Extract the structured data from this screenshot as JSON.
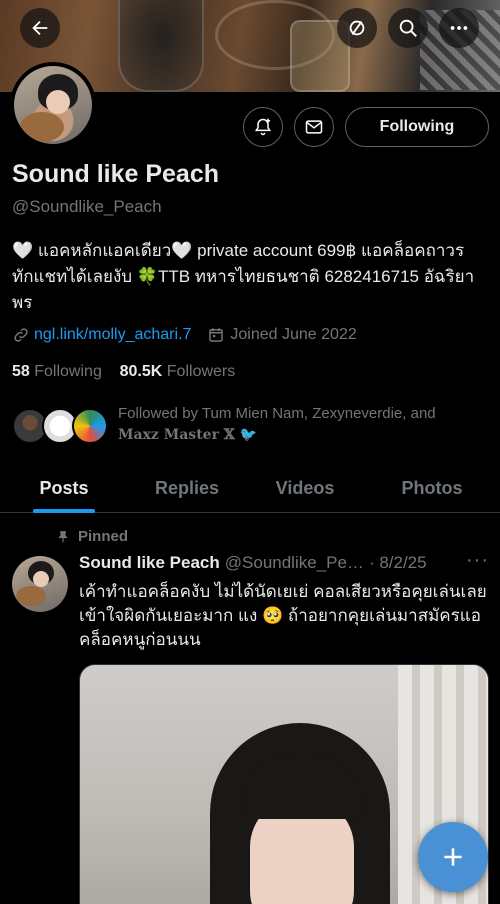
{
  "header": {
    "back_icon": "arrow-left-icon",
    "hide_icon": "circle-slash-icon",
    "search_icon": "search-icon",
    "more_icon": "more-horizontal-icon"
  },
  "profile": {
    "name": "Sound like Peach",
    "handle": "@Soundlike_Peach",
    "bio": "🤍 แอคหลักแอคเดียว🤍 private account 699฿ แอคล็อคถาวร ทักแชทได้เลยงับ 🍀TTB ทหารไทยธนชาติ 6282416715 อัฉริยาพร",
    "link": "ngl.link/molly_achari.7",
    "joined": "Joined June 2022",
    "following_count": "58",
    "following_label": "Following",
    "followers_count": "80.5K",
    "followers_label": "Followers",
    "followed_by_text": "Followed by Tum Mien Nam, Zexyneverdie, and",
    "followed_by_last": "Maxz Master 𝕏 🐦"
  },
  "actions": {
    "notify_icon": "bell-plus-icon",
    "message_icon": "mail-icon",
    "follow_label": "Following"
  },
  "tabs": [
    {
      "label": "Posts",
      "active": true
    },
    {
      "label": "Replies",
      "active": false
    },
    {
      "label": "Videos",
      "active": false
    },
    {
      "label": "Photos",
      "active": false
    }
  ],
  "post": {
    "pinned_label": "Pinned",
    "author_name": "Sound like Peach",
    "author_handle": "@Soundlike_Pe…",
    "date": "· 8/2/25",
    "more": "···",
    "text": "เค้าทำแอคล็อคงับ ไม่ได้นัดเยเย่ คอลเสียวหรือคุยเล่นเลย เข้าใจผิดกันเยอะมาก แง 🥺 ถ้าอยากคุยเล่นมาสมัครแอคล็อคหนูก่อนนน"
  },
  "colors": {
    "accent": "#1d9bf0",
    "muted": "#71767b",
    "text": "#e7e9ea",
    "fab": "#4a90d4"
  }
}
